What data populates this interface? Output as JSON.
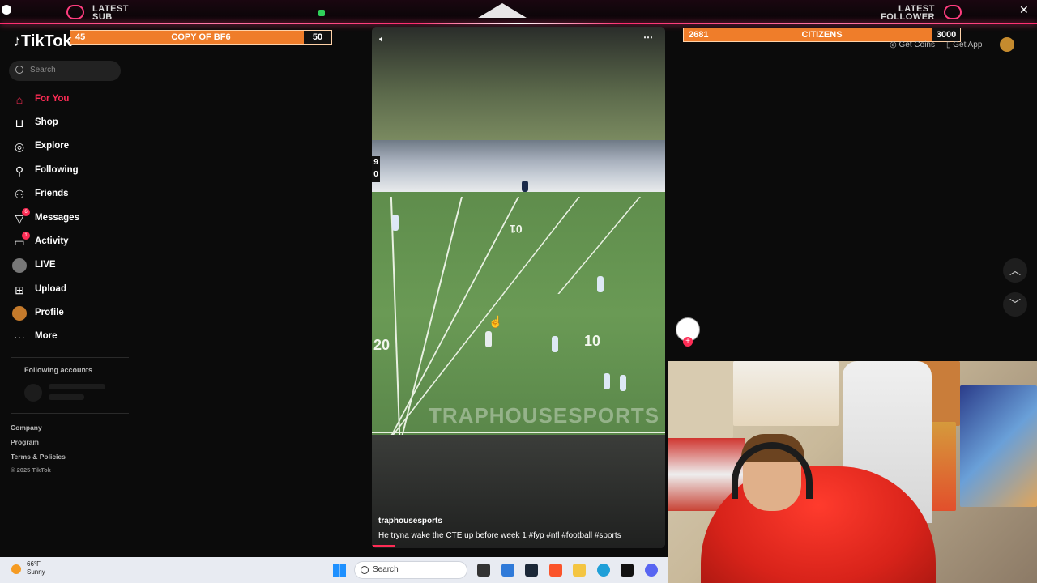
{
  "banner": {
    "latest_sub_label": "LATEST\nSUB",
    "latest_sub_l1": "LATEST",
    "latest_sub_l2": "SUB",
    "latest_follower_l1": "LATEST",
    "latest_follower_l2": "FOLLOWER",
    "sub_bar": {
      "count": "45",
      "name": "COPY OF BF6",
      "goal": "50"
    },
    "follower_bar": {
      "count": "2681",
      "name": "CITIZENS",
      "goal": "3000"
    },
    "accent": "#ff3d7f"
  },
  "tiktok": {
    "logo": "TikTok",
    "search_placeholder": "Search",
    "nav": [
      {
        "label": "For You",
        "icon": "home-icon",
        "active": true
      },
      {
        "label": "Shop",
        "icon": "shop-icon"
      },
      {
        "label": "Explore",
        "icon": "compass-icon"
      },
      {
        "label": "Following",
        "icon": "following-icon"
      },
      {
        "label": "Friends",
        "icon": "friends-icon"
      },
      {
        "label": "Messages",
        "icon": "messages-icon",
        "badge": "6"
      },
      {
        "label": "Activity",
        "icon": "activity-icon",
        "badge": "1"
      },
      {
        "label": "LIVE",
        "icon": "live-icon"
      },
      {
        "label": "Upload",
        "icon": "upload-icon"
      },
      {
        "label": "Profile",
        "icon": "profile-icon"
      },
      {
        "label": "More",
        "icon": "more-icon"
      }
    ],
    "following_accounts": "Following accounts",
    "footer": [
      "Company",
      "Program",
      "Terms & Policies",
      "© 2025 TikTok"
    ],
    "top_right": {
      "get_coins": "Get Coins",
      "get_app": "Get App"
    },
    "accent": "#fe2c55"
  },
  "video": {
    "username": "traphousesports",
    "caption": "He tryna wake the CTE up before week 1 #fyp  #nfl  #football  #sports",
    "watermark": "TRAPHOUSESPORTS",
    "yard_numbers": [
      "01",
      "20",
      "10"
    ],
    "score_digits": [
      "9",
      "0"
    ]
  },
  "taskbar": {
    "temperature": "66°F",
    "weather": "Sunny",
    "search_placeholder": "Search"
  }
}
